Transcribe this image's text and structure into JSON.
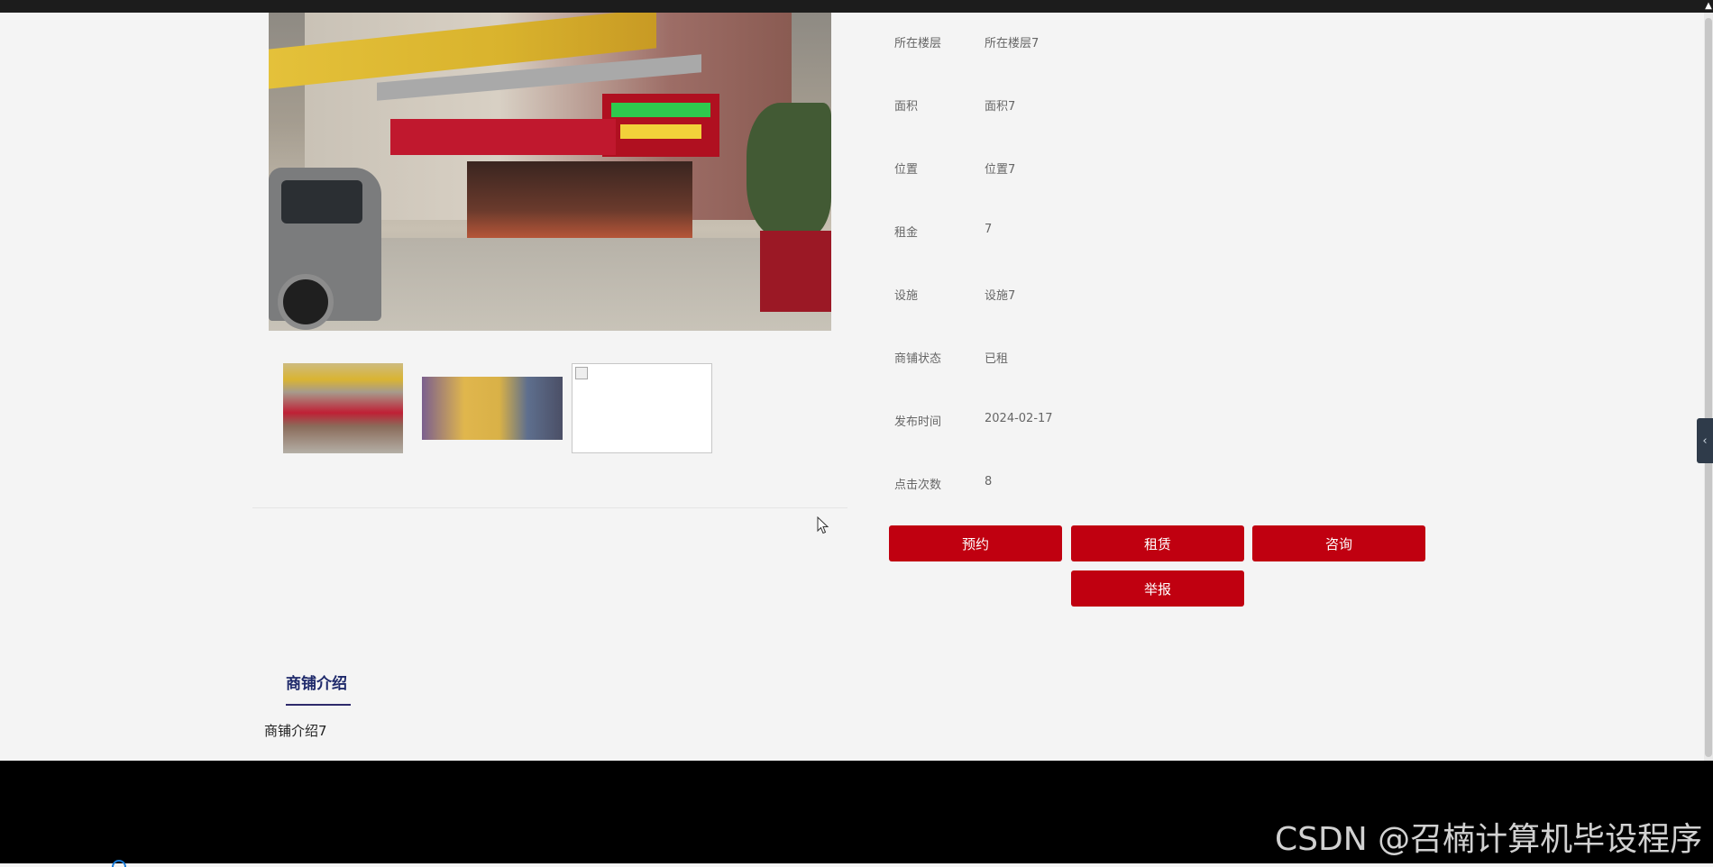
{
  "attributes": [
    {
      "label": "所在楼层",
      "value": "所在楼层7"
    },
    {
      "label": "面积",
      "value": "面积7"
    },
    {
      "label": "位置",
      "value": "位置7"
    },
    {
      "label": "租金",
      "value": "7"
    },
    {
      "label": "设施",
      "value": "设施7"
    },
    {
      "label": "商铺状态",
      "value": "已租"
    },
    {
      "label": "发布时间",
      "value": "2024-02-17"
    },
    {
      "label": "点击次数",
      "value": "8"
    }
  ],
  "actions": {
    "reserve": "预约",
    "rent": "租赁",
    "consult": "咨询",
    "report": "举报"
  },
  "intro": {
    "tab_label": "商铺介绍",
    "text": "商铺介绍7"
  },
  "watermark": "CSDN @召楠计算机毕设程序",
  "colors": {
    "accent_button": "#c00010",
    "tab_text": "#1f2a6b",
    "footer": "#000000"
  }
}
